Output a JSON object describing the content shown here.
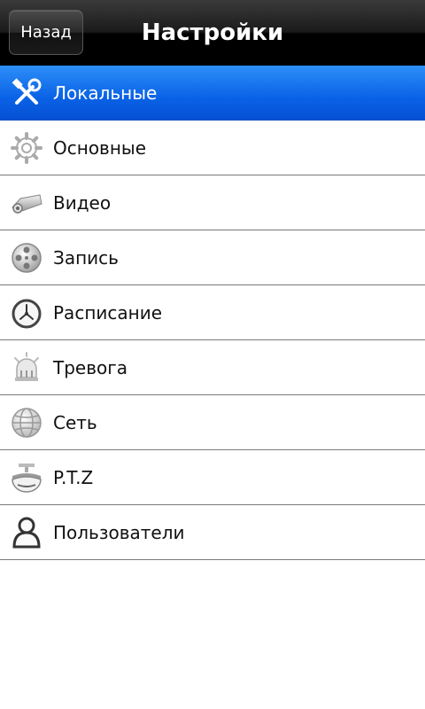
{
  "header": {
    "back_label": "Назад",
    "title": "Настройки"
  },
  "menu": {
    "items": [
      {
        "label": "Локальные",
        "icon": "tools-icon",
        "selected": true
      },
      {
        "label": "Основные",
        "icon": "gear-icon"
      },
      {
        "label": "Видео",
        "icon": "camera-icon"
      },
      {
        "label": "Запись",
        "icon": "film-reel-icon"
      },
      {
        "label": "Расписание",
        "icon": "clock-icon"
      },
      {
        "label": "Тревога",
        "icon": "alarm-icon"
      },
      {
        "label": "Сеть",
        "icon": "globe-icon"
      },
      {
        "label": "P.T.Z",
        "icon": "ptz-camera-icon"
      },
      {
        "label": "Пользователи",
        "icon": "user-icon"
      }
    ]
  },
  "colors": {
    "selected_gradient_top": "#2d8ff8",
    "selected_gradient_bottom": "#0650d4",
    "header_black": "#000000"
  }
}
